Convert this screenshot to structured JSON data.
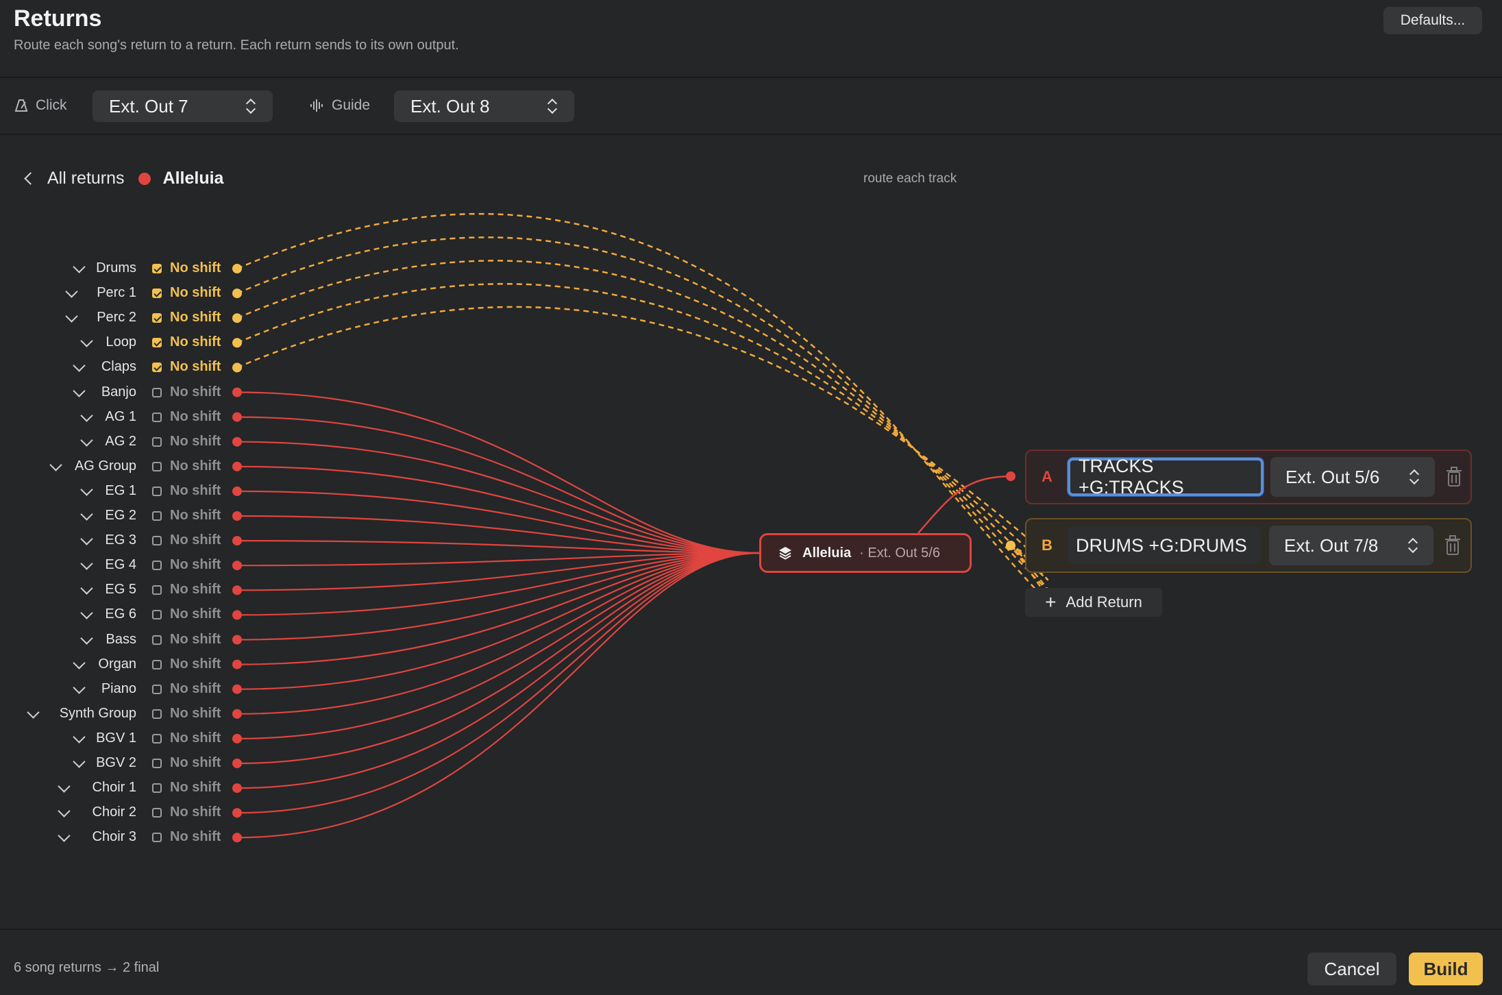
{
  "header": {
    "title": "Returns",
    "subtitle": "Route each song's return to a return. Each return sends to its own output.",
    "defaults_label": "Defaults..."
  },
  "toolbar": {
    "click_label": "Click",
    "click_value": "Ext. Out 7",
    "guide_label": "Guide",
    "guide_value": "Ext. Out 8"
  },
  "breadcrumb": {
    "back_label": "All returns",
    "song": "Alleluia",
    "song_color": "#e0453f",
    "hint": "route each track"
  },
  "tracks": [
    {
      "name": "Drums",
      "shift": "No shift",
      "checked": true
    },
    {
      "name": "Perc 1",
      "shift": "No shift",
      "checked": true
    },
    {
      "name": "Perc 2",
      "shift": "No shift",
      "checked": true
    },
    {
      "name": "Loop",
      "shift": "No shift",
      "checked": true
    },
    {
      "name": "Claps",
      "shift": "No shift",
      "checked": true
    },
    {
      "name": "Banjo",
      "shift": "No shift",
      "checked": false
    },
    {
      "name": "AG 1",
      "shift": "No shift",
      "checked": false
    },
    {
      "name": "AG 2",
      "shift": "No shift",
      "checked": false
    },
    {
      "name": "AG Group",
      "shift": "No shift",
      "checked": false
    },
    {
      "name": "EG 1",
      "shift": "No shift",
      "checked": false
    },
    {
      "name": "EG 2",
      "shift": "No shift",
      "checked": false
    },
    {
      "name": "EG 3",
      "shift": "No shift",
      "checked": false
    },
    {
      "name": "EG 4",
      "shift": "No shift",
      "checked": false
    },
    {
      "name": "EG 5",
      "shift": "No shift",
      "checked": false
    },
    {
      "name": "EG 6",
      "shift": "No shift",
      "checked": false
    },
    {
      "name": "Bass",
      "shift": "No shift",
      "checked": false
    },
    {
      "name": "Organ",
      "shift": "No shift",
      "checked": false
    },
    {
      "name": "Piano",
      "shift": "No shift",
      "checked": false
    },
    {
      "name": "Synth Group",
      "shift": "No shift",
      "checked": false
    },
    {
      "name": "BGV 1",
      "shift": "No shift",
      "checked": false
    },
    {
      "name": "BGV 2",
      "shift": "No shift",
      "checked": false
    },
    {
      "name": "Choir 1",
      "shift": "No shift",
      "checked": false
    },
    {
      "name": "Choir 2",
      "shift": "No shift",
      "checked": false
    },
    {
      "name": "Choir 3",
      "shift": "No shift",
      "checked": false
    }
  ],
  "song_node": {
    "name": "Alleluia",
    "output": "· Ext. Out 5/6",
    "icon": "stack-icon"
  },
  "returns": [
    {
      "letter": "A",
      "name": "TRACKS +G:TRACKS",
      "output": "Ext. Out 5/6",
      "color": "#e0453f"
    },
    {
      "letter": "B",
      "name": "DRUMS +G:DRUMS",
      "output": "Ext. Out 7/8",
      "color": "#f2a93b"
    }
  ],
  "add_return_label": "Add Return",
  "footer": {
    "summary": "6 song returns → 2 final",
    "cancel_label": "Cancel",
    "build_label": "Build"
  },
  "colors": {
    "red": "#e0453f",
    "yellow": "#f2c04e",
    "orange_dash": "#f2a93b"
  }
}
